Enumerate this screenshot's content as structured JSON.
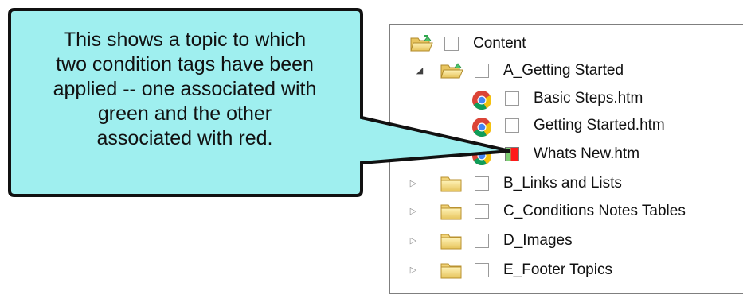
{
  "callout": {
    "lines": [
      "This shows a topic to which",
      "two condition tags have been",
      "applied -- one associated with",
      "green and the other",
      "associated with red."
    ]
  },
  "tree": {
    "items": [
      {
        "label": "Content",
        "icon": "open-folder-icon",
        "expander": ""
      },
      {
        "label": "A_Getting Started",
        "icon": "open-folder-icon",
        "expander": "◢"
      },
      {
        "label": "Basic Steps.htm",
        "icon": "chrome-icon",
        "expander": ""
      },
      {
        "label": "Getting Started.htm",
        "icon": "chrome-icon",
        "expander": ""
      },
      {
        "label": "Whats New.htm",
        "icon": "chrome-icon",
        "expander": "",
        "condition_tags": [
          "#7fcf74",
          "#ff1a1a"
        ]
      },
      {
        "label": "B_Links and Lists",
        "icon": "folder-icon",
        "expander": "▷"
      },
      {
        "label": "C_Conditions Notes Tables",
        "icon": "folder-icon",
        "expander": "▷"
      },
      {
        "label": "D_Images",
        "icon": "folder-icon",
        "expander": "▷"
      },
      {
        "label": "E_Footer Topics",
        "icon": "folder-icon",
        "expander": "▷"
      }
    ]
  },
  "colors": {
    "callout_fill": "#9fefef",
    "callout_border": "#111111",
    "tag_green": "#7fcf74",
    "tag_red": "#ff1a1a"
  }
}
